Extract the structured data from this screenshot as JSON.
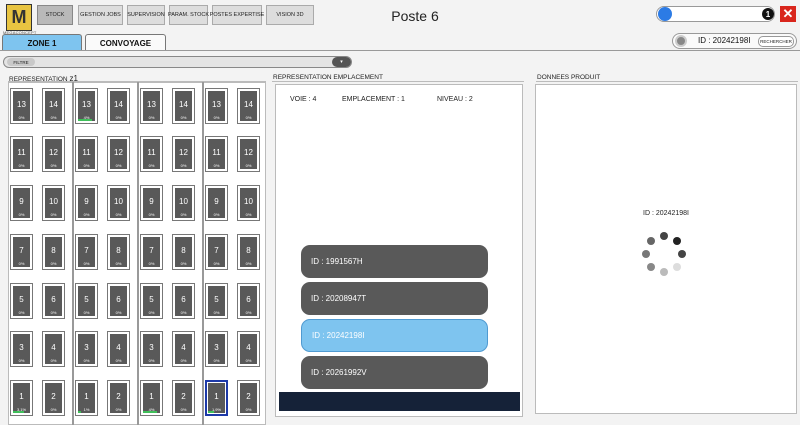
{
  "logo": {
    "letter": "M",
    "text": "MEGACONCEPT"
  },
  "nav": [
    "STOCK",
    "GESTION JOBS",
    "SUPERVISION",
    "PARAM. STOCK",
    "POSTES EXPERTISE",
    "VISION 3D"
  ],
  "title": "Poste 6",
  "search": {
    "badge": "1",
    "placeholder": ""
  },
  "close": "✕",
  "tabs": [
    "ZONE 1",
    "CONVOYAGE"
  ],
  "id_search": {
    "label": "ID : 20242198I",
    "button": "RECHERCHER"
  },
  "filter": {
    "label": "FILTRE",
    "arrow": "▾"
  },
  "panels": {
    "grid_title": "REPRESENTATION",
    "grid_zone": "z1",
    "emp_title": "REPRESENTATION  EMPLACEMENT",
    "data_title": "DONNEES PRODUIT"
  },
  "emp": {
    "voie": "VOIE : 4",
    "emplacement": "EMPLACEMENT : 1",
    "niveau": "NIVEAU : 2"
  },
  "id_list": [
    {
      "label": "ID : 1991567H",
      "active": false
    },
    {
      "label": "ID : 20208947T",
      "active": false
    },
    {
      "label": "ID : 20242198I",
      "active": true
    },
    {
      "label": "ID : 20261992V",
      "active": false
    }
  ],
  "product": {
    "id": "ID : 20242198I"
  },
  "grid": {
    "columns": 4,
    "rows": [
      {
        "left": [
          "13",
          "14"
        ],
        "pcts": [
          [
            "0%",
            "0%"
          ],
          [
            "4%",
            "0%"
          ],
          [
            "0%",
            "0%"
          ],
          [
            "0%",
            "0%"
          ]
        ]
      },
      {
        "left": [
          "11",
          "12"
        ],
        "pcts": [
          [
            "0%",
            "0%"
          ],
          [
            "0%",
            "0%"
          ],
          [
            "0%",
            "0%"
          ],
          [
            "0%",
            "0%"
          ]
        ]
      },
      {
        "left": [
          "9",
          "10"
        ],
        "pcts": [
          [
            "0%",
            "0%"
          ],
          [
            "0%",
            "0%"
          ],
          [
            "0%",
            "0%"
          ],
          [
            "0%",
            "0%"
          ]
        ]
      },
      {
        "left": [
          "7",
          "8"
        ],
        "pcts": [
          [
            "0%",
            "0%"
          ],
          [
            "0%",
            "0%"
          ],
          [
            "0%",
            "0%"
          ],
          [
            "0%",
            "0%"
          ]
        ]
      },
      {
        "left": [
          "5",
          "6"
        ],
        "pcts": [
          [
            "0%",
            "0%"
          ],
          [
            "0%",
            "0%"
          ],
          [
            "0%",
            "0%"
          ],
          [
            "0%",
            "0%"
          ]
        ]
      },
      {
        "left": [
          "3",
          "4"
        ],
        "pcts": [
          [
            "0%",
            "0%"
          ],
          [
            "0%",
            "0%"
          ],
          [
            "0%",
            "0%"
          ],
          [
            "0%",
            "0%"
          ]
        ]
      },
      {
        "left": [
          "1",
          "2"
        ],
        "pcts": [
          [
            "3,1%",
            "0%"
          ],
          [
            "1%",
            "0%"
          ],
          [
            "4%",
            "0%"
          ],
          [
            "1,9%",
            "0%"
          ]
        ]
      }
    ],
    "selected": {
      "column": 3,
      "row": 6,
      "slot": 0
    },
    "accent": "#3fbf5a"
  },
  "colors": {
    "accent_blue": "#7ec4ef",
    "dark": "#595959",
    "close": "#d9261c",
    "selection": "#1e3aa8"
  }
}
